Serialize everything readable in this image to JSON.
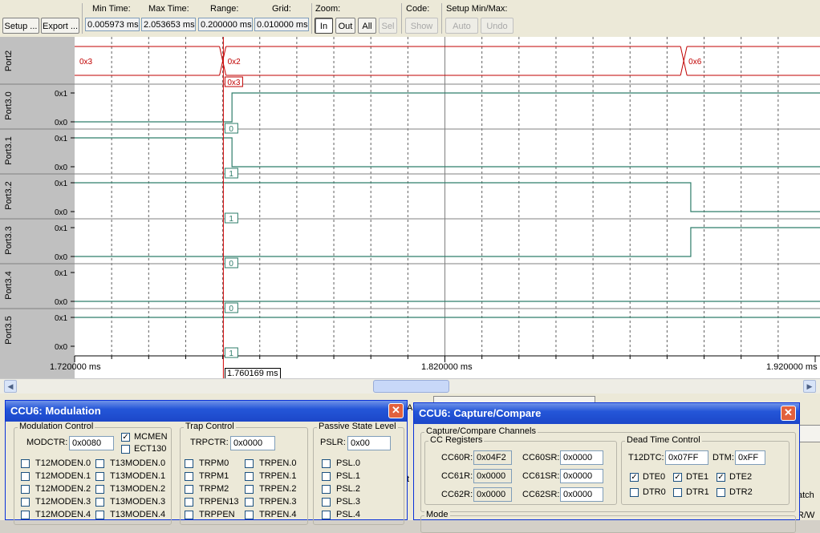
{
  "toolbar": {
    "setup_label": "Setup ...",
    "export_label": "Export ...",
    "min_time_label": "Min Time:",
    "min_time_value": "0.005973 ms",
    "max_time_label": "Max Time:",
    "max_time_value": "2.053653 ms",
    "range_label": "Range:",
    "range_value": "0.200000 ms",
    "grid_label": "Grid:",
    "grid_value": "0.010000 ms",
    "zoom_label": "Zoom:",
    "zoom_in": "In",
    "zoom_out": "Out",
    "zoom_all": "All",
    "zoom_sel": "Sel",
    "code_label": "Code:",
    "code_show": "Show",
    "setup_minmax_label": "Setup Min/Max:",
    "auto_label": "Auto",
    "undo_label": "Undo"
  },
  "analyzer": {
    "signals": [
      {
        "name": "Port2",
        "type": "bus",
        "segments": [
          {
            "from": 1.72,
            "value": "0x3"
          },
          {
            "from": 1.76,
            "value": "0x2"
          },
          {
            "from": 1.8845,
            "value": "0x6"
          }
        ],
        "cursor_value": "0x3"
      },
      {
        "name": "Port3.0",
        "top_tick": "0x1",
        "bottom_tick": "0x0",
        "edges": [
          {
            "t": 1.72,
            "v": 0
          },
          {
            "t": 1.7625,
            "v": 1
          }
        ],
        "cursor_value": "0"
      },
      {
        "name": "Port3.1",
        "top_tick": "0x1",
        "bottom_tick": "0x0",
        "edges": [
          {
            "t": 1.72,
            "v": 1
          },
          {
            "t": 1.7625,
            "v": 0
          }
        ],
        "cursor_value": "1"
      },
      {
        "name": "Port3.2",
        "top_tick": "0x1",
        "bottom_tick": "0x0",
        "edges": [
          {
            "t": 1.72,
            "v": 1
          },
          {
            "t": 1.8864,
            "v": 0
          }
        ],
        "cursor_value": "1"
      },
      {
        "name": "Port3.3",
        "top_tick": "0x1",
        "bottom_tick": "0x0",
        "edges": [
          {
            "t": 1.72,
            "v": 0
          },
          {
            "t": 1.8864,
            "v": 1
          }
        ],
        "cursor_value": "0"
      },
      {
        "name": "Port3.4",
        "top_tick": "0x1",
        "bottom_tick": "0x0",
        "edges": [
          {
            "t": 1.72,
            "v": 0
          }
        ],
        "cursor_value": "0"
      },
      {
        "name": "Port3.5",
        "top_tick": "0x1",
        "bottom_tick": "0x0",
        "edges": [
          {
            "t": 1.72,
            "v": 1
          }
        ],
        "cursor_value": "1"
      }
    ],
    "time_start": 1.72,
    "time_end": 1.92,
    "grid_step": 0.01,
    "cursor_time": 1.760169,
    "time_labels": [
      "1.720000 ms",
      "1.820000 ms",
      "1.920000 ms"
    ],
    "cursor_label": "1.760169 ms",
    "colors": {
      "bus": "#c00000",
      "signal": "#2e7d6a",
      "cursor": "#d00000",
      "grid": "#808080"
    }
  },
  "modulation": {
    "title": "CCU6: Modulation",
    "modulation_control_title": "Modulation Control",
    "modctr_label": "MODCTR:",
    "modctr_value": "0x0080",
    "mcmen_label": "MCMEN",
    "mcmen_checked": true,
    "ect130_label": "ECT130",
    "ect130_checked": false,
    "col1": [
      "T12MODEN.0",
      "T12MODEN.1",
      "T12MODEN.2",
      "T12MODEN.3",
      "T12MODEN.4"
    ],
    "col2": [
      "T13MODEN.0",
      "T13MODEN.1",
      "T13MODEN.2",
      "T13MODEN.3",
      "T13MODEN.4"
    ],
    "trap_control_title": "Trap Control",
    "trpctr_label": "TRPCTR:",
    "trpctr_value": "0x0000",
    "trap_col1": [
      "TRPM0",
      "TRPM1",
      "TRPM2",
      "TRPEN13",
      "TRPPEN"
    ],
    "trap_col2": [
      "TRPEN.0",
      "TRPEN.1",
      "TRPEN.2",
      "TRPEN.3",
      "TRPEN.4"
    ],
    "passive_title": "Passive State Level",
    "pslr_label": "PSLR:",
    "pslr_value": "0x00",
    "psl": [
      "PSL.0",
      "PSL.1",
      "PSL.2",
      "PSL.3",
      "PSL.4"
    ]
  },
  "capture": {
    "title": "CCU6: Capture/Compare",
    "channels_title": "Capture/Compare Channels",
    "cc_registers_title": "CC Registers",
    "cc60r_label": "CC60R:",
    "cc60r_value": "0x04F2",
    "cc61r_label": "CC61R:",
    "cc61r_value": "0x0000",
    "cc62r_label": "CC62R:",
    "cc62r_value": "0x0000",
    "cc60sr_label": "CC60SR:",
    "cc60sr_value": "0x0000",
    "cc61sr_label": "CC61SR:",
    "cc61sr_value": "0x0000",
    "cc62sr_label": "CC62SR:",
    "cc62sr_value": "0x0000",
    "dead_time_title": "Dead Time Control",
    "t12dtc_label": "T12DTC:",
    "t12dtc_value": "0x07FF",
    "dtm_label": "DTM:",
    "dtm_value": "0xFF",
    "dte": [
      {
        "label": "DTE0",
        "checked": true
      },
      {
        "label": "DTE1",
        "checked": true
      },
      {
        "label": "DTE2",
        "checked": true
      }
    ],
    "dtr": [
      {
        "label": "DTR0",
        "checked": false
      },
      {
        "label": "DTR1",
        "checked": false
      },
      {
        "label": "DTR2",
        "checked": false
      }
    ],
    "mode_title": "Mode"
  },
  "background": {
    "fragment1": "A",
    "fragment2": "t",
    "fragment3": "atch",
    "fragment4": "R/W"
  }
}
